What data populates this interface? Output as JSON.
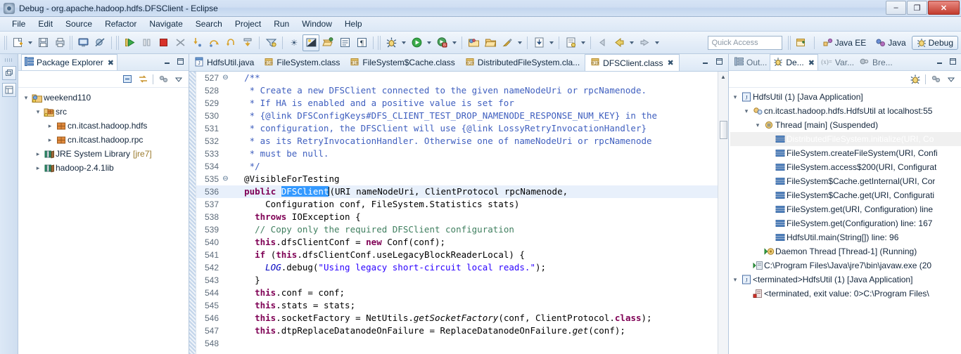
{
  "window": {
    "title": "Debug - org.apache.hadoop.hdfs.DFSClient - Eclipse",
    "app_icon": "eclipse-icon",
    "minimize": "–",
    "maximize": "❐",
    "close": "✕"
  },
  "menubar": {
    "items": [
      "File",
      "Edit",
      "Source",
      "Refactor",
      "Navigate",
      "Search",
      "Project",
      "Run",
      "Window",
      "Help"
    ]
  },
  "toolbar": {
    "buttons": [
      {
        "name": "new-wizard-icon",
        "glyph": "🗋"
      },
      {
        "name": "new-dropdown-caret",
        "glyph": "▾"
      },
      {
        "name": "save-icon",
        "glyph": "💾"
      },
      {
        "name": "print-icon",
        "glyph": "🖶"
      },
      {
        "name": "open-console-icon",
        "glyph": "🖵"
      },
      {
        "name": "skip-breakpoints-icon",
        "glyph": "⊘"
      },
      {
        "name": "resume-icon",
        "glyph": "▶"
      },
      {
        "name": "suspend-icon",
        "glyph": "‖"
      },
      {
        "name": "terminate-icon",
        "glyph": "■"
      },
      {
        "name": "disconnect-icon",
        "glyph": "✂"
      },
      {
        "name": "step-into-icon",
        "glyph": "↴"
      },
      {
        "name": "step-over-icon",
        "glyph": "↷"
      },
      {
        "name": "step-return-icon",
        "glyph": "↰"
      },
      {
        "name": "drop-to-frame-icon",
        "glyph": "⇥"
      },
      {
        "name": "use-step-filters-icon",
        "glyph": "∇"
      },
      {
        "name": "debug-launch-icon",
        "glyph": "☀"
      },
      {
        "name": "toggle-mark-occurrences-icon",
        "glyph": "◩"
      },
      {
        "name": "open-type-icon",
        "glyph": "↳"
      },
      {
        "name": "open-task-icon",
        "glyph": "▤"
      },
      {
        "name": "show-whitespace-icon",
        "glyph": "¶"
      },
      {
        "name": "debug-perspective-icon",
        "glyph": "✻"
      },
      {
        "name": "debug-caret",
        "glyph": "▾"
      },
      {
        "name": "run-icon",
        "glyph": "▶"
      },
      {
        "name": "run-caret",
        "glyph": "▾"
      },
      {
        "name": "coverage-icon",
        "glyph": "◐"
      },
      {
        "name": "coverage-caret",
        "glyph": "▾"
      },
      {
        "name": "new-java-package-icon",
        "glyph": "📁"
      },
      {
        "name": "open-folder-icon",
        "glyph": "📂"
      },
      {
        "name": "external-tools-icon",
        "glyph": "✎"
      },
      {
        "name": "external-tools-caret",
        "glyph": "▾"
      },
      {
        "name": "download-icon",
        "glyph": "↓"
      },
      {
        "name": "download-caret",
        "glyph": "▾"
      },
      {
        "name": "annotation-icon",
        "glyph": "🗎"
      },
      {
        "name": "annotation-caret",
        "glyph": "▾"
      },
      {
        "name": "back-small-icon",
        "glyph": "←"
      },
      {
        "name": "back-icon",
        "glyph": "←"
      },
      {
        "name": "back-caret",
        "glyph": "▾"
      },
      {
        "name": "forward-icon",
        "glyph": "→"
      },
      {
        "name": "forward-caret",
        "glyph": "▾"
      }
    ],
    "quick_access_placeholder": "Quick Access"
  },
  "perspectives": {
    "open_perspective_icon": "open-perspective-icon",
    "items": [
      {
        "label": "Java EE",
        "icon": "java-ee-perspective-icon",
        "active": false
      },
      {
        "label": "Java",
        "icon": "java-perspective-icon",
        "active": false
      },
      {
        "label": "Debug",
        "icon": "debug-perspective-icon",
        "active": true
      }
    ]
  },
  "fastview": {
    "buttons": [
      {
        "name": "restore-view-icon",
        "glyph": "❐"
      },
      {
        "name": "package-explorer-fastview-icon",
        "glyph": "▥"
      }
    ]
  },
  "package_explorer": {
    "tab_label": "Package Explorer",
    "tab_icon": "package-explorer-icon",
    "close_glyph": "✖",
    "minimize_glyph": "–",
    "maximize_glyph": "❐",
    "toolbar": [
      {
        "name": "collapse-all-icon",
        "glyph": "⊟"
      },
      {
        "name": "link-with-editor-icon",
        "glyph": "⇄"
      },
      {
        "name": "focus-on-active-task-icon",
        "glyph": "❂"
      },
      {
        "name": "view-menu-icon",
        "glyph": "▽"
      }
    ],
    "tree": [
      {
        "label": "weekend110",
        "icon": "java-project-icon",
        "indent": 0,
        "arrow": "▾"
      },
      {
        "label": "src",
        "icon": "source-folder-icon",
        "indent": 1,
        "arrow": "▾"
      },
      {
        "label": "cn.itcast.hadoop.hdfs",
        "icon": "package-icon",
        "indent": 2,
        "arrow": "▸"
      },
      {
        "label": "cn.itcast.hadoop.rpc",
        "icon": "package-icon",
        "indent": 2,
        "arrow": "▸"
      },
      {
        "label": "JRE System Library",
        "suffix": "[jre7]",
        "icon": "library-icon",
        "indent": 1,
        "arrow": "▸"
      },
      {
        "label": "hadoop-2.4.1lib",
        "icon": "library-icon",
        "indent": 1,
        "arrow": "▸"
      }
    ]
  },
  "editor": {
    "tabs": [
      {
        "label": "HdfsUtil.java",
        "icon": "java-file-icon",
        "active": false
      },
      {
        "label": "FileSystem.class",
        "icon": "class-file-icon",
        "active": false
      },
      {
        "label": "FileSystem$Cache.class",
        "icon": "class-file-icon",
        "active": false
      },
      {
        "label": "DistributedFileSystem.cla...",
        "icon": "class-file-icon",
        "active": false
      },
      {
        "label": "DFSClient.class",
        "icon": "class-file-icon",
        "active": true
      }
    ],
    "active_close_glyph": "✖",
    "minimize_glyph": "–",
    "maximize_glyph": "❐",
    "scrollbar": {
      "up_glyph": "▲",
      "down_glyph": "▼"
    },
    "lines": [
      {
        "num": "527",
        "fold": "⊖",
        "highlight": false,
        "tokens": [
          {
            "t": "  ",
            "c": ""
          },
          {
            "t": "/**",
            "c": "jd"
          }
        ]
      },
      {
        "num": "528",
        "fold": "",
        "highlight": false,
        "tokens": [
          {
            "t": "   * Create a new DFSClient connected to the given nameNodeUri or rpcNamenode.",
            "c": "jd"
          }
        ]
      },
      {
        "num": "529",
        "fold": "",
        "highlight": false,
        "tokens": [
          {
            "t": "   * If HA is enabled and a positive value is set for",
            "c": "jd"
          }
        ]
      },
      {
        "num": "530",
        "fold": "",
        "highlight": false,
        "tokens": [
          {
            "t": "   * {@link DFSConfigKeys#DFS_CLIENT_TEST_DROP_NAMENODE_RESPONSE_NUM_KEY} in the",
            "c": "jd"
          }
        ]
      },
      {
        "num": "531",
        "fold": "",
        "highlight": false,
        "tokens": [
          {
            "t": "   * configuration, the DFSClient will use {@link LossyRetryInvocationHandler}",
            "c": "jd"
          }
        ]
      },
      {
        "num": "532",
        "fold": "",
        "highlight": false,
        "tokens": [
          {
            "t": "   * as its RetryInvocationHandler. Otherwise one of nameNodeUri or rpcNamenode",
            "c": "jd"
          }
        ]
      },
      {
        "num": "533",
        "fold": "",
        "highlight": false,
        "tokens": [
          {
            "t": "   * must be null.",
            "c": "jd"
          }
        ]
      },
      {
        "num": "534",
        "fold": "",
        "highlight": false,
        "tokens": [
          {
            "t": "   */",
            "c": "jd"
          }
        ]
      },
      {
        "num": "535",
        "fold": "⊖",
        "highlight": false,
        "tokens": [
          {
            "t": "  @VisibleForTesting",
            "c": ""
          }
        ]
      },
      {
        "num": "536",
        "fold": "",
        "highlight": true,
        "tokens": [
          {
            "t": "  ",
            "c": ""
          },
          {
            "t": "public",
            "c": "kw"
          },
          {
            "t": " ",
            "c": ""
          },
          {
            "t": "DFSClient",
            "c": "sel"
          },
          {
            "t": "▏",
            "c": "caret"
          },
          {
            "t": "(URI nameNodeUri, ClientProtocol rpcNamenode,",
            "c": ""
          }
        ]
      },
      {
        "num": "537",
        "fold": "",
        "highlight": false,
        "tokens": [
          {
            "t": "      Configuration conf, FileSystem.Statistics stats)",
            "c": ""
          }
        ]
      },
      {
        "num": "538",
        "fold": "",
        "highlight": false,
        "tokens": [
          {
            "t": "    ",
            "c": ""
          },
          {
            "t": "throws",
            "c": "kw"
          },
          {
            "t": " IOException {",
            "c": ""
          }
        ]
      },
      {
        "num": "539",
        "fold": "",
        "highlight": false,
        "tokens": [
          {
            "t": "    ",
            "c": ""
          },
          {
            "t": "// Copy only the required DFSClient configuration",
            "c": "cm"
          }
        ]
      },
      {
        "num": "540",
        "fold": "",
        "highlight": false,
        "tokens": [
          {
            "t": "    ",
            "c": ""
          },
          {
            "t": "this",
            "c": "kw"
          },
          {
            "t": ".dfsClientConf = ",
            "c": ""
          },
          {
            "t": "new",
            "c": "kw"
          },
          {
            "t": " Conf(conf);",
            "c": ""
          }
        ]
      },
      {
        "num": "541",
        "fold": "",
        "highlight": false,
        "tokens": [
          {
            "t": "    ",
            "c": ""
          },
          {
            "t": "if",
            "c": "kw"
          },
          {
            "t": " (",
            "c": ""
          },
          {
            "t": "this",
            "c": "kw"
          },
          {
            "t": ".dfsClientConf.useLegacyBlockReaderLocal) {",
            "c": ""
          }
        ]
      },
      {
        "num": "542",
        "fold": "",
        "highlight": false,
        "tokens": [
          {
            "t": "      ",
            "c": ""
          },
          {
            "t": "LOG",
            "c": "fldst"
          },
          {
            "t": ".debug(",
            "c": ""
          },
          {
            "t": "\"Using legacy short-circuit local reads.\"",
            "c": "str"
          },
          {
            "t": ");",
            "c": ""
          }
        ]
      },
      {
        "num": "543",
        "fold": "",
        "highlight": false,
        "tokens": [
          {
            "t": "    }",
            "c": ""
          }
        ]
      },
      {
        "num": "544",
        "fold": "",
        "highlight": false,
        "tokens": [
          {
            "t": "    ",
            "c": ""
          },
          {
            "t": "this",
            "c": "kw"
          },
          {
            "t": ".conf = conf;",
            "c": ""
          }
        ]
      },
      {
        "num": "545",
        "fold": "",
        "highlight": false,
        "tokens": [
          {
            "t": "    ",
            "c": ""
          },
          {
            "t": "this",
            "c": "kw"
          },
          {
            "t": ".stats = stats;",
            "c": ""
          }
        ]
      },
      {
        "num": "546",
        "fold": "",
        "highlight": false,
        "tokens": [
          {
            "t": "    ",
            "c": ""
          },
          {
            "t": "this",
            "c": "kw"
          },
          {
            "t": ".socketFactory = NetUtils.",
            "c": ""
          },
          {
            "t": "getSocketFactory",
            "c": "stat"
          },
          {
            "t": "(conf, ClientProtocol.",
            "c": ""
          },
          {
            "t": "class",
            "c": "kw"
          },
          {
            "t": ");",
            "c": ""
          }
        ]
      },
      {
        "num": "547",
        "fold": "",
        "highlight": false,
        "tokens": [
          {
            "t": "    ",
            "c": ""
          },
          {
            "t": "this",
            "c": "kw"
          },
          {
            "t": ".dtpReplaceDatanodeOnFailure = ReplaceDatanodeOnFailure.",
            "c": ""
          },
          {
            "t": "get",
            "c": "stat"
          },
          {
            "t": "(conf);",
            "c": ""
          }
        ]
      },
      {
        "num": "548",
        "fold": "",
        "highlight": false,
        "tokens": [
          {
            "t": "",
            "c": ""
          }
        ]
      }
    ]
  },
  "debug_view": {
    "tabs": [
      {
        "label": "Out...",
        "icon": "outline-icon",
        "active": false
      },
      {
        "label": "De...",
        "icon": "debug-icon",
        "active": true
      },
      {
        "label": "Var...",
        "icon": "variables-icon",
        "active": false
      },
      {
        "label": "Bre...",
        "icon": "breakpoints-icon",
        "active": false
      }
    ],
    "active_close_glyph": "✖",
    "minimize_glyph": "–",
    "maximize_glyph": "❐",
    "toolbar": [
      {
        "name": "debug-view-icon",
        "glyph": "✻"
      },
      {
        "name": "view-filters-icon",
        "glyph": "❂"
      },
      {
        "name": "view-menu-icon",
        "glyph": "▽"
      }
    ],
    "tree": [
      {
        "label": "HdfsUtil (1) [Java Application]",
        "icon": "launch-icon",
        "indent": 0,
        "arrow": "▾",
        "selected": false
      },
      {
        "label": "cn.itcast.hadoop.hdfs.HdfsUtil at localhost:55",
        "icon": "debug-target-icon",
        "indent": 1,
        "arrow": "▾",
        "selected": false
      },
      {
        "label": "Thread [main] (Suspended)",
        "icon": "thread-suspended-icon",
        "indent": 2,
        "arrow": "▾",
        "selected": false
      },
      {
        "label": "DistributedFileSystem.initialize(URI, Co",
        "icon": "stack-frame-icon",
        "indent": 3,
        "arrow": "",
        "selected": true
      },
      {
        "label": "FileSystem.createFileSystem(URI, Confi",
        "icon": "stack-frame-icon",
        "indent": 3,
        "arrow": "",
        "selected": false
      },
      {
        "label": "FileSystem.access$200(URI, Configurat",
        "icon": "stack-frame-icon",
        "indent": 3,
        "arrow": "",
        "selected": false
      },
      {
        "label": "FileSystem$Cache.getInternal(URI, Cor",
        "icon": "stack-frame-icon",
        "indent": 3,
        "arrow": "",
        "selected": false
      },
      {
        "label": "FileSystem$Cache.get(URI, Configurati",
        "icon": "stack-frame-icon",
        "indent": 3,
        "arrow": "",
        "selected": false
      },
      {
        "label": "FileSystem.get(URI, Configuration) line",
        "icon": "stack-frame-icon",
        "indent": 3,
        "arrow": "",
        "selected": false
      },
      {
        "label": "FileSystem.get(Configuration) line: 167",
        "icon": "stack-frame-icon",
        "indent": 3,
        "arrow": "",
        "selected": false
      },
      {
        "label": "HdfsUtil.main(String[]) line: 96",
        "icon": "stack-frame-icon",
        "indent": 3,
        "arrow": "",
        "selected": false
      },
      {
        "label": "Daemon Thread [Thread-1] (Running)",
        "icon": "thread-running-icon",
        "indent": 2,
        "arrow": "",
        "selected": false
      },
      {
        "label": "C:\\Program Files\\Java\\jre7\\bin\\javaw.exe (20",
        "icon": "process-icon",
        "indent": 1,
        "arrow": "",
        "selected": false
      },
      {
        "label": "<terminated>HdfsUtil (1) [Java Application]",
        "icon": "launch-icon",
        "indent": 0,
        "arrow": "▾",
        "selected": false
      },
      {
        "label": "<terminated, exit value: 0>C:\\Program Files\\",
        "icon": "terminated-process-icon",
        "indent": 1,
        "arrow": "",
        "selected": false
      }
    ]
  },
  "colors": {
    "keyword": "#7f0055",
    "comment": "#3f7f5f",
    "javadoc": "#3f5fbf",
    "string": "#2a00ff",
    "selection": "#3399ff",
    "highlight_line": "#e8f0fb",
    "accent": "#c23c2e"
  }
}
